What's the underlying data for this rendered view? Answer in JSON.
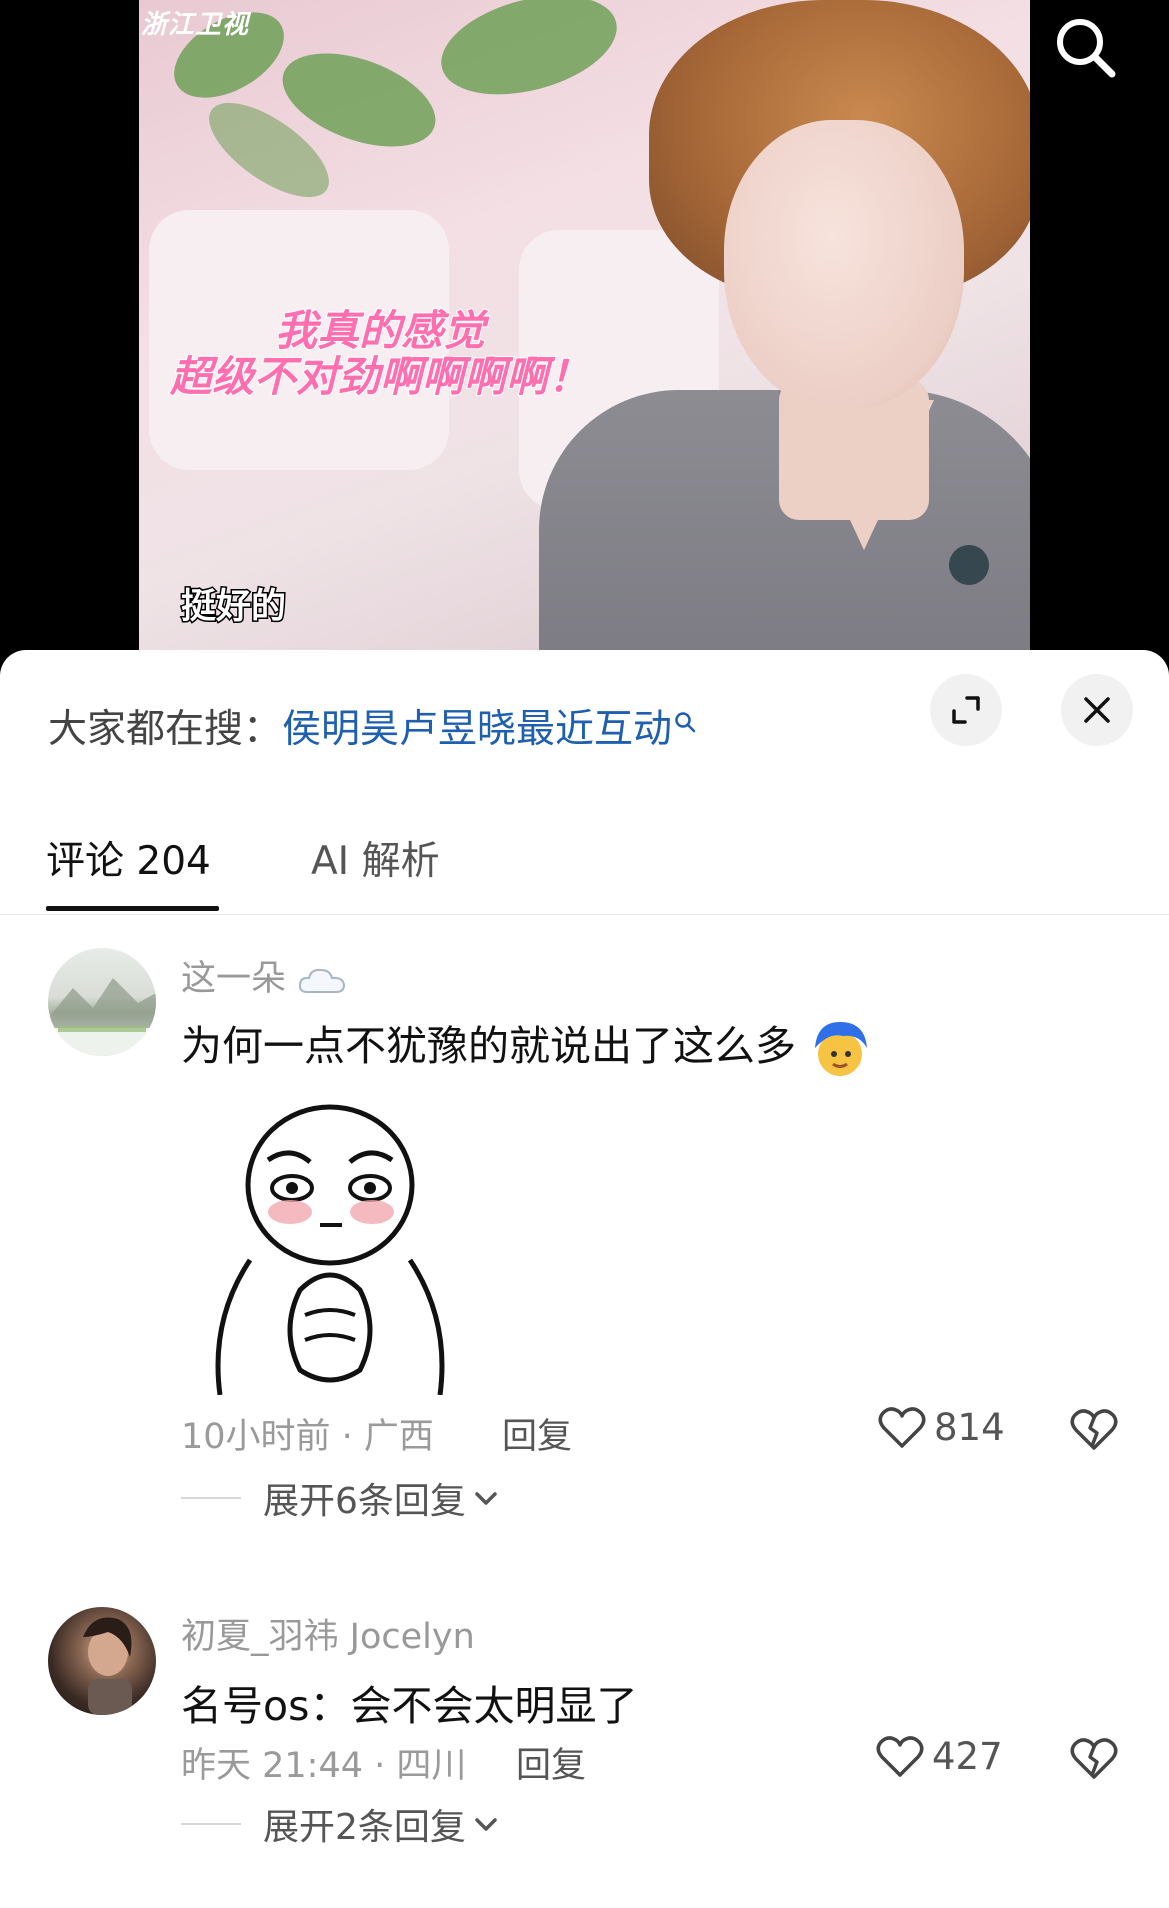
{
  "video": {
    "channel_logo": "浙江卫视",
    "caption_line1": "我真的感觉",
    "caption_line2": "超级不对劲啊啊啊啊！",
    "subtitle": "挺好的"
  },
  "sheet": {
    "trending_label": "大家都在搜：",
    "trending_term": "侯明昊卢昱晓最近互动",
    "tabs": [
      {
        "label": "评论 204"
      },
      {
        "label": "AI 解析"
      }
    ]
  },
  "comments": [
    {
      "username": "这一朵",
      "text": "为何一点不犹豫的就说出了这么多",
      "meta": "10小时前 · 广西",
      "reply_label": "回复",
      "likes": "814",
      "expand_label": "展开6条回复"
    },
    {
      "username": "初夏_羽祎 Jocelyn",
      "text": "名号os：会不会太明显了",
      "meta": "昨天 21:44 · 四川",
      "reply_label": "回复",
      "likes": "427",
      "expand_label": "展开2条回复"
    }
  ],
  "colors": {
    "trending_term": "#1f5fb0",
    "caption_pink": "#ff6fb0",
    "sheet_bg": "#ffffff",
    "muted_text": "#9a9a9a"
  },
  "icons": [
    "search-icon",
    "small-search-icon",
    "expand-icon",
    "close-icon",
    "cloud-emoji-icon",
    "blue-hair-emoji-icon",
    "heart-icon",
    "broken-heart-icon",
    "chevron-down-icon"
  ]
}
